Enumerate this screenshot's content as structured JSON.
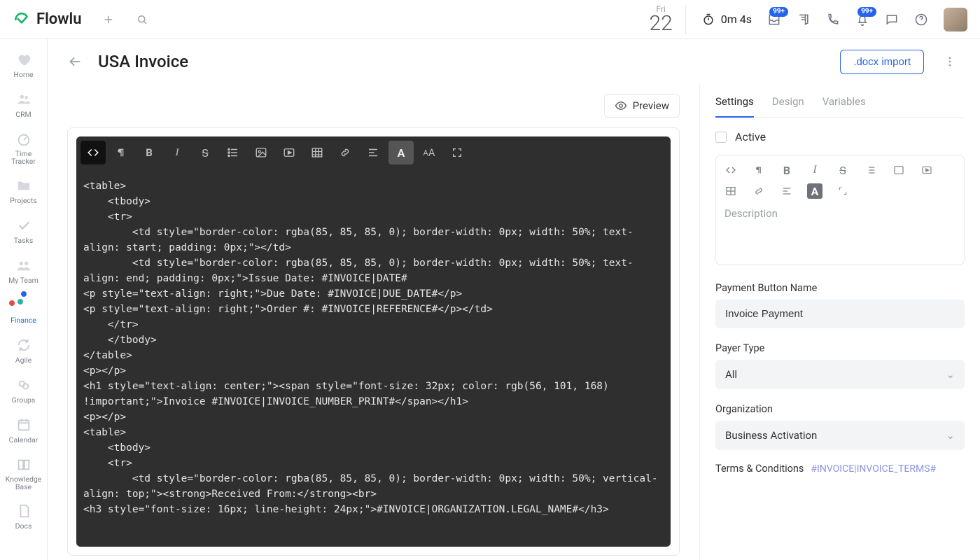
{
  "brand": "Flowlu",
  "top": {
    "date_day": "Fri",
    "date_num": "22",
    "timer": "0m 4s",
    "badge1": "99+",
    "badge2": "99+"
  },
  "leftnav": [
    {
      "id": "home",
      "label": "Home"
    },
    {
      "id": "crm",
      "label": "CRM"
    },
    {
      "id": "time-tracker",
      "label": "Time Tracker"
    },
    {
      "id": "projects",
      "label": "Projects"
    },
    {
      "id": "tasks",
      "label": "Tasks"
    },
    {
      "id": "my-team",
      "label": "My Team"
    },
    {
      "id": "finance",
      "label": "Finance",
      "active": true
    },
    {
      "id": "agile",
      "label": "Agile"
    },
    {
      "id": "groups",
      "label": "Groups"
    },
    {
      "id": "calendar",
      "label": "Calendar"
    },
    {
      "id": "knowledge-base",
      "label": "Knowledge Base"
    },
    {
      "id": "docs",
      "label": "Docs"
    }
  ],
  "page": {
    "title": "USA Invoice",
    "docx_btn": ".docx import",
    "preview": "Preview"
  },
  "editor": {
    "code": "<table>\n    <tbody>\n    <tr>\n        <td style=\"border-color: rgba(85, 85, 85, 0); border-width: 0px; width: 50%; text-align: start; padding: 0px;\"></td>\n        <td style=\"border-color: rgba(85, 85, 85, 0); border-width: 0px; width: 50%; text-align: end; padding: 0px;\">Issue Date: #INVOICE|DATE#\n<p style=\"text-align: right;\">Due Date: #INVOICE|DUE_DATE#</p>\n<p style=\"text-align: right;\">Order #: #INVOICE|REFERENCE#</p></td>\n    </tr>\n    </tbody>\n</table>\n<p></p>\n<h1 style=\"text-align: center;\"><span style=\"font-size: 32px; color: rgb(56, 101, 168) !important;\">Invoice #INVOICE|INVOICE_NUMBER_PRINT#</span></h1>\n<p></p>\n<table>\n    <tbody>\n    <tr>\n        <td style=\"border-color: rgba(85, 85, 85, 0); border-width: 0px; width: 50%; vertical-align: top;\"><strong>Received From:</strong><br>\n<h3 style=\"font-size: 16px; line-height: 24px;\">#INVOICE|ORGANIZATION.LEGAL_NAME#</h3>"
  },
  "side": {
    "tabs": {
      "settings": "Settings",
      "design": "Design",
      "variables": "Variables"
    },
    "active_tab": "settings",
    "active_label": "Active",
    "desc_placeholder": "Description",
    "payment_btn_label": "Payment Button Name",
    "payment_btn_value": "Invoice Payment",
    "payer_type_label": "Payer Type",
    "payer_type_value": "All",
    "org_label": "Organization",
    "org_value": "Business Activation",
    "tc_label": "Terms & Conditions",
    "tc_var": "#INVOICE|INVOICE_TERMS#"
  }
}
